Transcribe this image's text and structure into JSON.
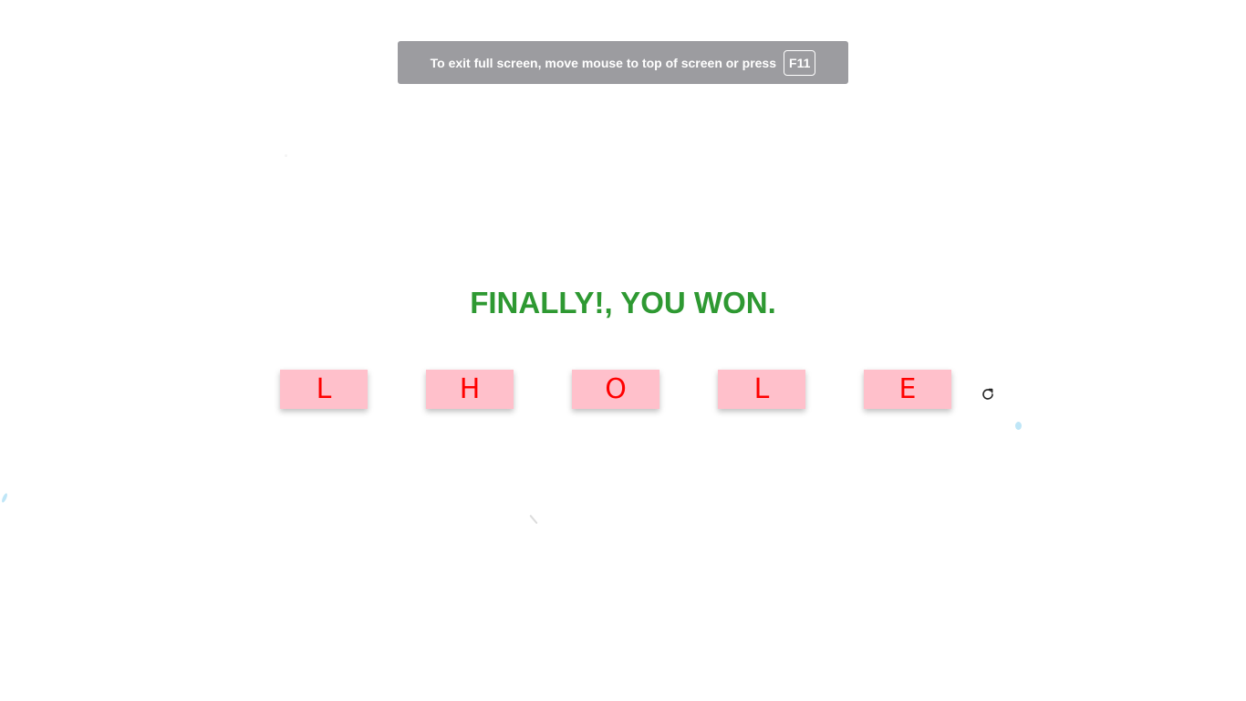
{
  "fullscreen_notice": {
    "message": "To exit full screen, move mouse to top of screen or press",
    "key": "F11"
  },
  "game": {
    "result_message": "FINALLY!, YOU WON.",
    "tiles": [
      "L",
      "H",
      "O",
      "L",
      "E"
    ],
    "tile_color": "#ffc0cb",
    "letter_color": "#ff0000",
    "result_color": "#2e9932",
    "reload_icon": "reload-icon"
  }
}
